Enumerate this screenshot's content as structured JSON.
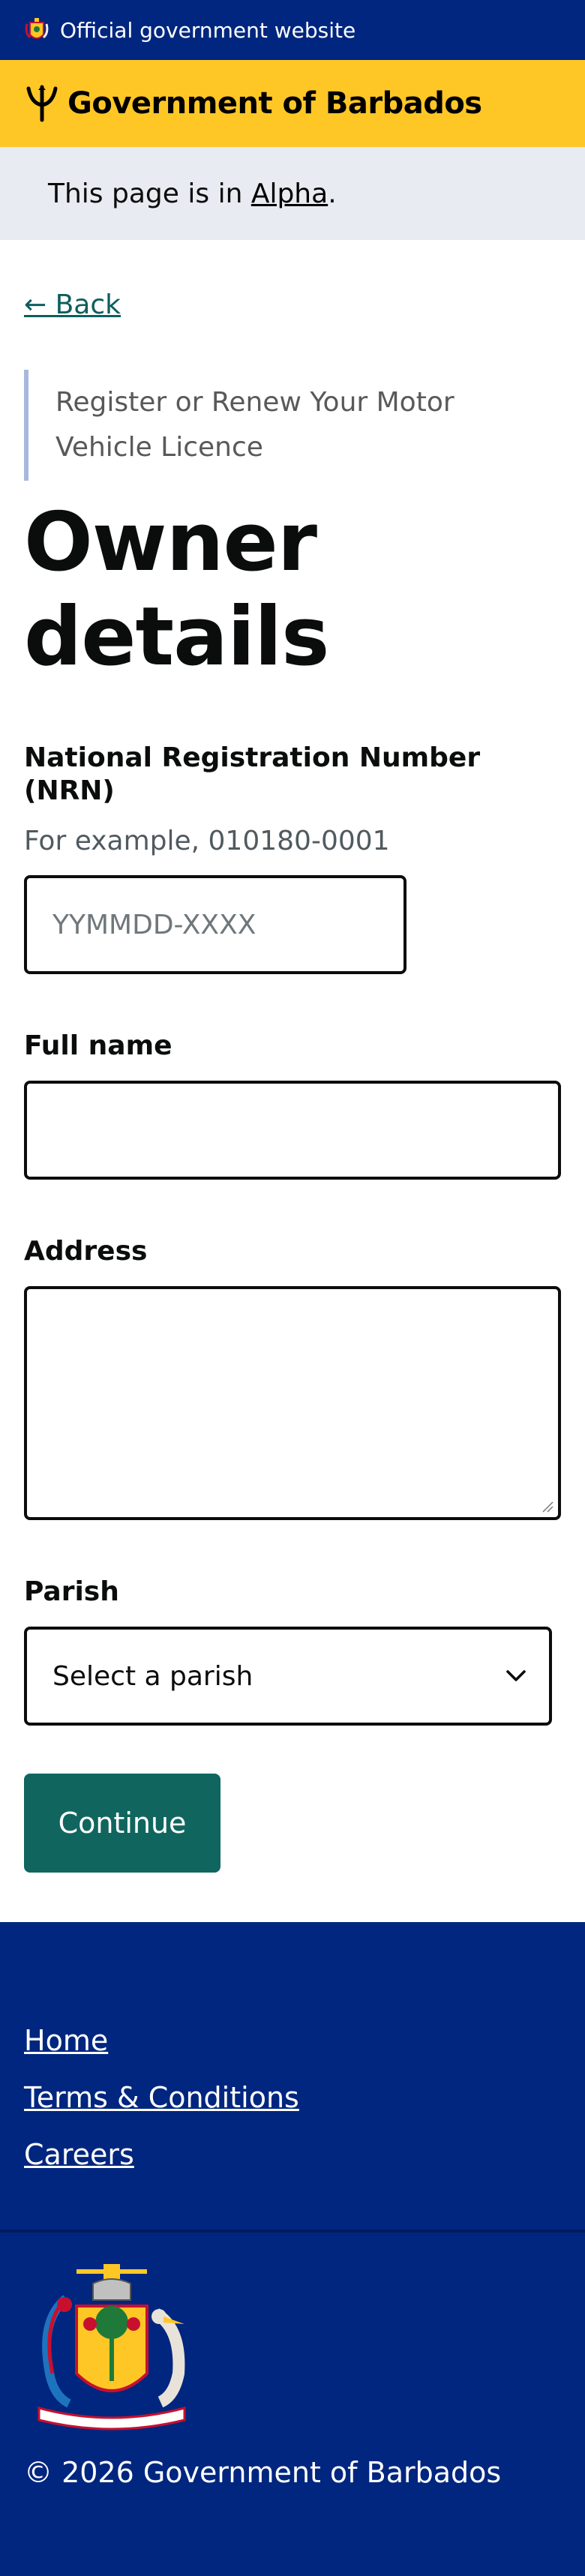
{
  "header": {
    "official_text": "Official government website",
    "brand": "Government of Barbados",
    "colors": {
      "top": "#00267f",
      "brand": "#ffc726"
    }
  },
  "phase_banner": {
    "prefix": "This page is in ",
    "link": "Alpha",
    "suffix": "."
  },
  "back_link": "← Back",
  "caption": "Register or Renew Your Motor Vehicle Licence",
  "title": "Owner details",
  "form": {
    "nrn": {
      "label": "National Registration Number (NRN)",
      "hint": "For example, 010180-0001",
      "placeholder": "YYMMDD-XXXX",
      "value": ""
    },
    "full_name": {
      "label": "Full name",
      "value": ""
    },
    "address": {
      "label": "Address",
      "value": ""
    },
    "parish": {
      "label": "Parish",
      "selected": "Select a parish"
    },
    "continue_label": "Continue"
  },
  "footer": {
    "links": [
      "Home",
      "Terms & Conditions",
      "Careers"
    ],
    "copyright": "© 2026 Government of Barbados"
  },
  "colors": {
    "accent": "#10665f",
    "footer": "#00267f"
  }
}
